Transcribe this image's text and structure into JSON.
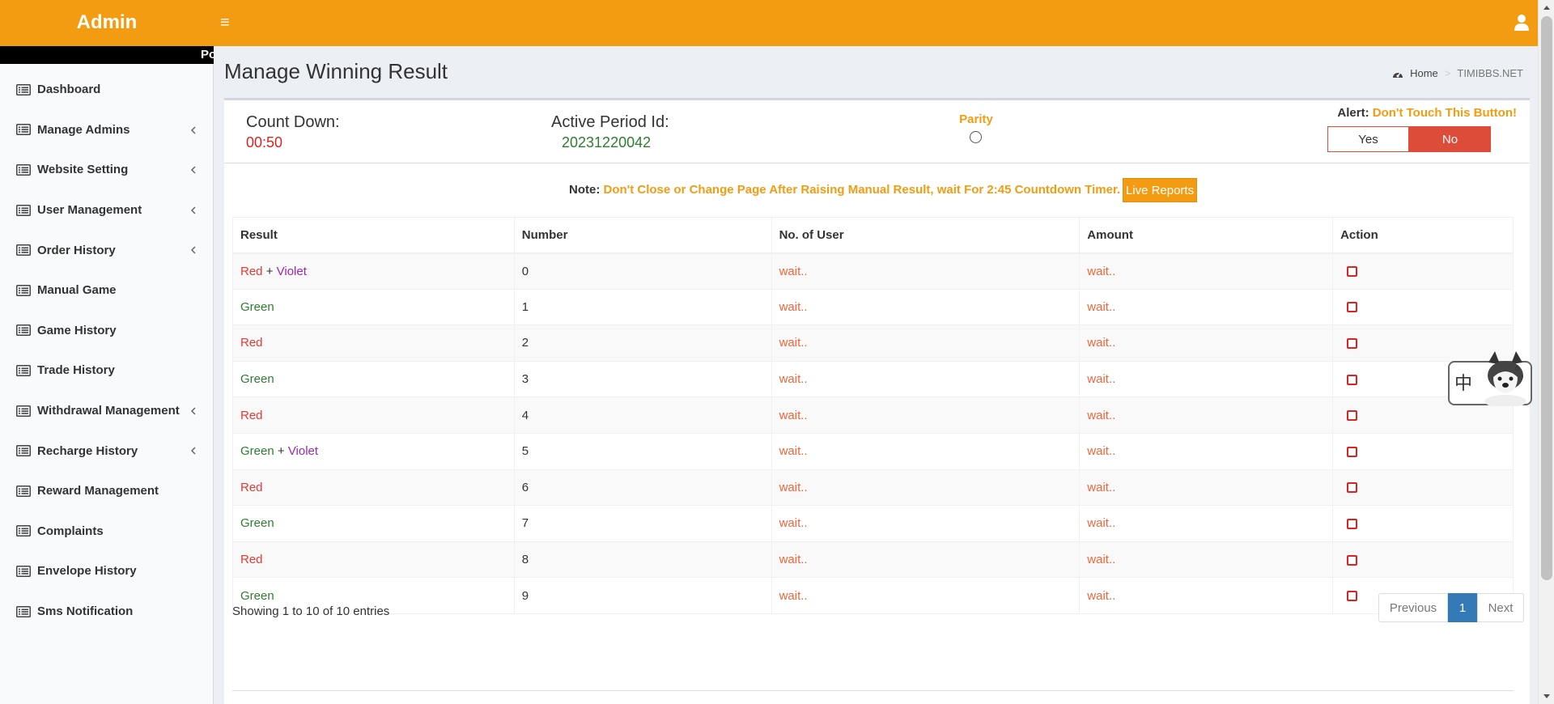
{
  "header": {
    "logo": "Admin",
    "menu_toggle": "≡"
  },
  "sidebar": {
    "marquee": "Po",
    "items": [
      {
        "label": "Dashboard",
        "has_submenu": false
      },
      {
        "label": "Manage Admins",
        "has_submenu": true
      },
      {
        "label": "Website Setting",
        "has_submenu": true
      },
      {
        "label": "User Management",
        "has_submenu": true
      },
      {
        "label": "Order History",
        "has_submenu": true
      },
      {
        "label": "Manual Game",
        "has_submenu": false
      },
      {
        "label": "Game History",
        "has_submenu": false
      },
      {
        "label": "Trade History",
        "has_submenu": false
      },
      {
        "label": "Withdrawal Management",
        "has_submenu": true
      },
      {
        "label": "Recharge History",
        "has_submenu": true
      },
      {
        "label": "Reward Management",
        "has_submenu": false
      },
      {
        "label": "Complaints",
        "has_submenu": false
      },
      {
        "label": "Envelope History",
        "has_submenu": false
      },
      {
        "label": "Sms Notification",
        "has_submenu": false
      }
    ]
  },
  "page": {
    "title": "Manage Winning Result",
    "breadcrumb": {
      "home": "Home",
      "separator": ">",
      "current": "TIMIBBS.NET"
    }
  },
  "stats": {
    "countdown_label": "Count Down:",
    "countdown_value": "00:50",
    "period_label": "Active Period Id:",
    "period_value": "20231220042",
    "parity_label": "Parity",
    "alert_label": "Alert:",
    "alert_message": "Don't Touch This Button!",
    "yes_label": "Yes",
    "no_label": "No",
    "selected": "No"
  },
  "note": {
    "label": "Note:",
    "message": "Don't Close or Change Page After Raising Manual Result, wait For 2:45 Countdown Timer.",
    "live_reports": "Live Reports"
  },
  "table": {
    "headers": [
      "Result",
      "Number",
      "No. of User",
      "Amount",
      "Action"
    ],
    "rows": [
      {
        "result": "Red",
        "plus": " + ",
        "violet": "Violet",
        "color": "red",
        "number": "0",
        "users": "wait..",
        "amount": "wait.."
      },
      {
        "result": "Green",
        "plus": "",
        "violet": "",
        "color": "green",
        "number": "1",
        "users": "wait..",
        "amount": "wait.."
      },
      {
        "result": "Red",
        "plus": "",
        "violet": "",
        "color": "red",
        "number": "2",
        "users": "wait..",
        "amount": "wait.."
      },
      {
        "result": "Green",
        "plus": "",
        "violet": "",
        "color": "green",
        "number": "3",
        "users": "wait..",
        "amount": "wait.."
      },
      {
        "result": "Red",
        "plus": "",
        "violet": "",
        "color": "red",
        "number": "4",
        "users": "wait..",
        "amount": "wait.."
      },
      {
        "result": "Green",
        "plus": " + ",
        "violet": "Violet",
        "color": "green",
        "number": "5",
        "users": "wait..",
        "amount": "wait.."
      },
      {
        "result": "Red",
        "plus": "",
        "violet": "",
        "color": "red",
        "number": "6",
        "users": "wait..",
        "amount": "wait.."
      },
      {
        "result": "Green",
        "plus": "",
        "violet": "",
        "color": "green",
        "number": "7",
        "users": "wait..",
        "amount": "wait.."
      },
      {
        "result": "Red",
        "plus": "",
        "violet": "",
        "color": "red",
        "number": "8",
        "users": "wait..",
        "amount": "wait.."
      },
      {
        "result": "Green",
        "plus": "",
        "violet": "",
        "color": "green",
        "number": "9",
        "users": "wait..",
        "amount": "wait.."
      }
    ]
  },
  "footer": {
    "entries": "Showing 1 to 10 of 10 entries",
    "prev": "Previous",
    "current_page": "1",
    "next": "Next"
  },
  "ime": {
    "char": "中",
    "punct": "°,"
  },
  "colors": {
    "header": "#f39c12",
    "red": "#e53935",
    "green": "#2e7d32",
    "violet": "#9c27b0",
    "wait": "#f0663a",
    "pager_active": "#337ab7",
    "no_button": "#dd4b39"
  }
}
